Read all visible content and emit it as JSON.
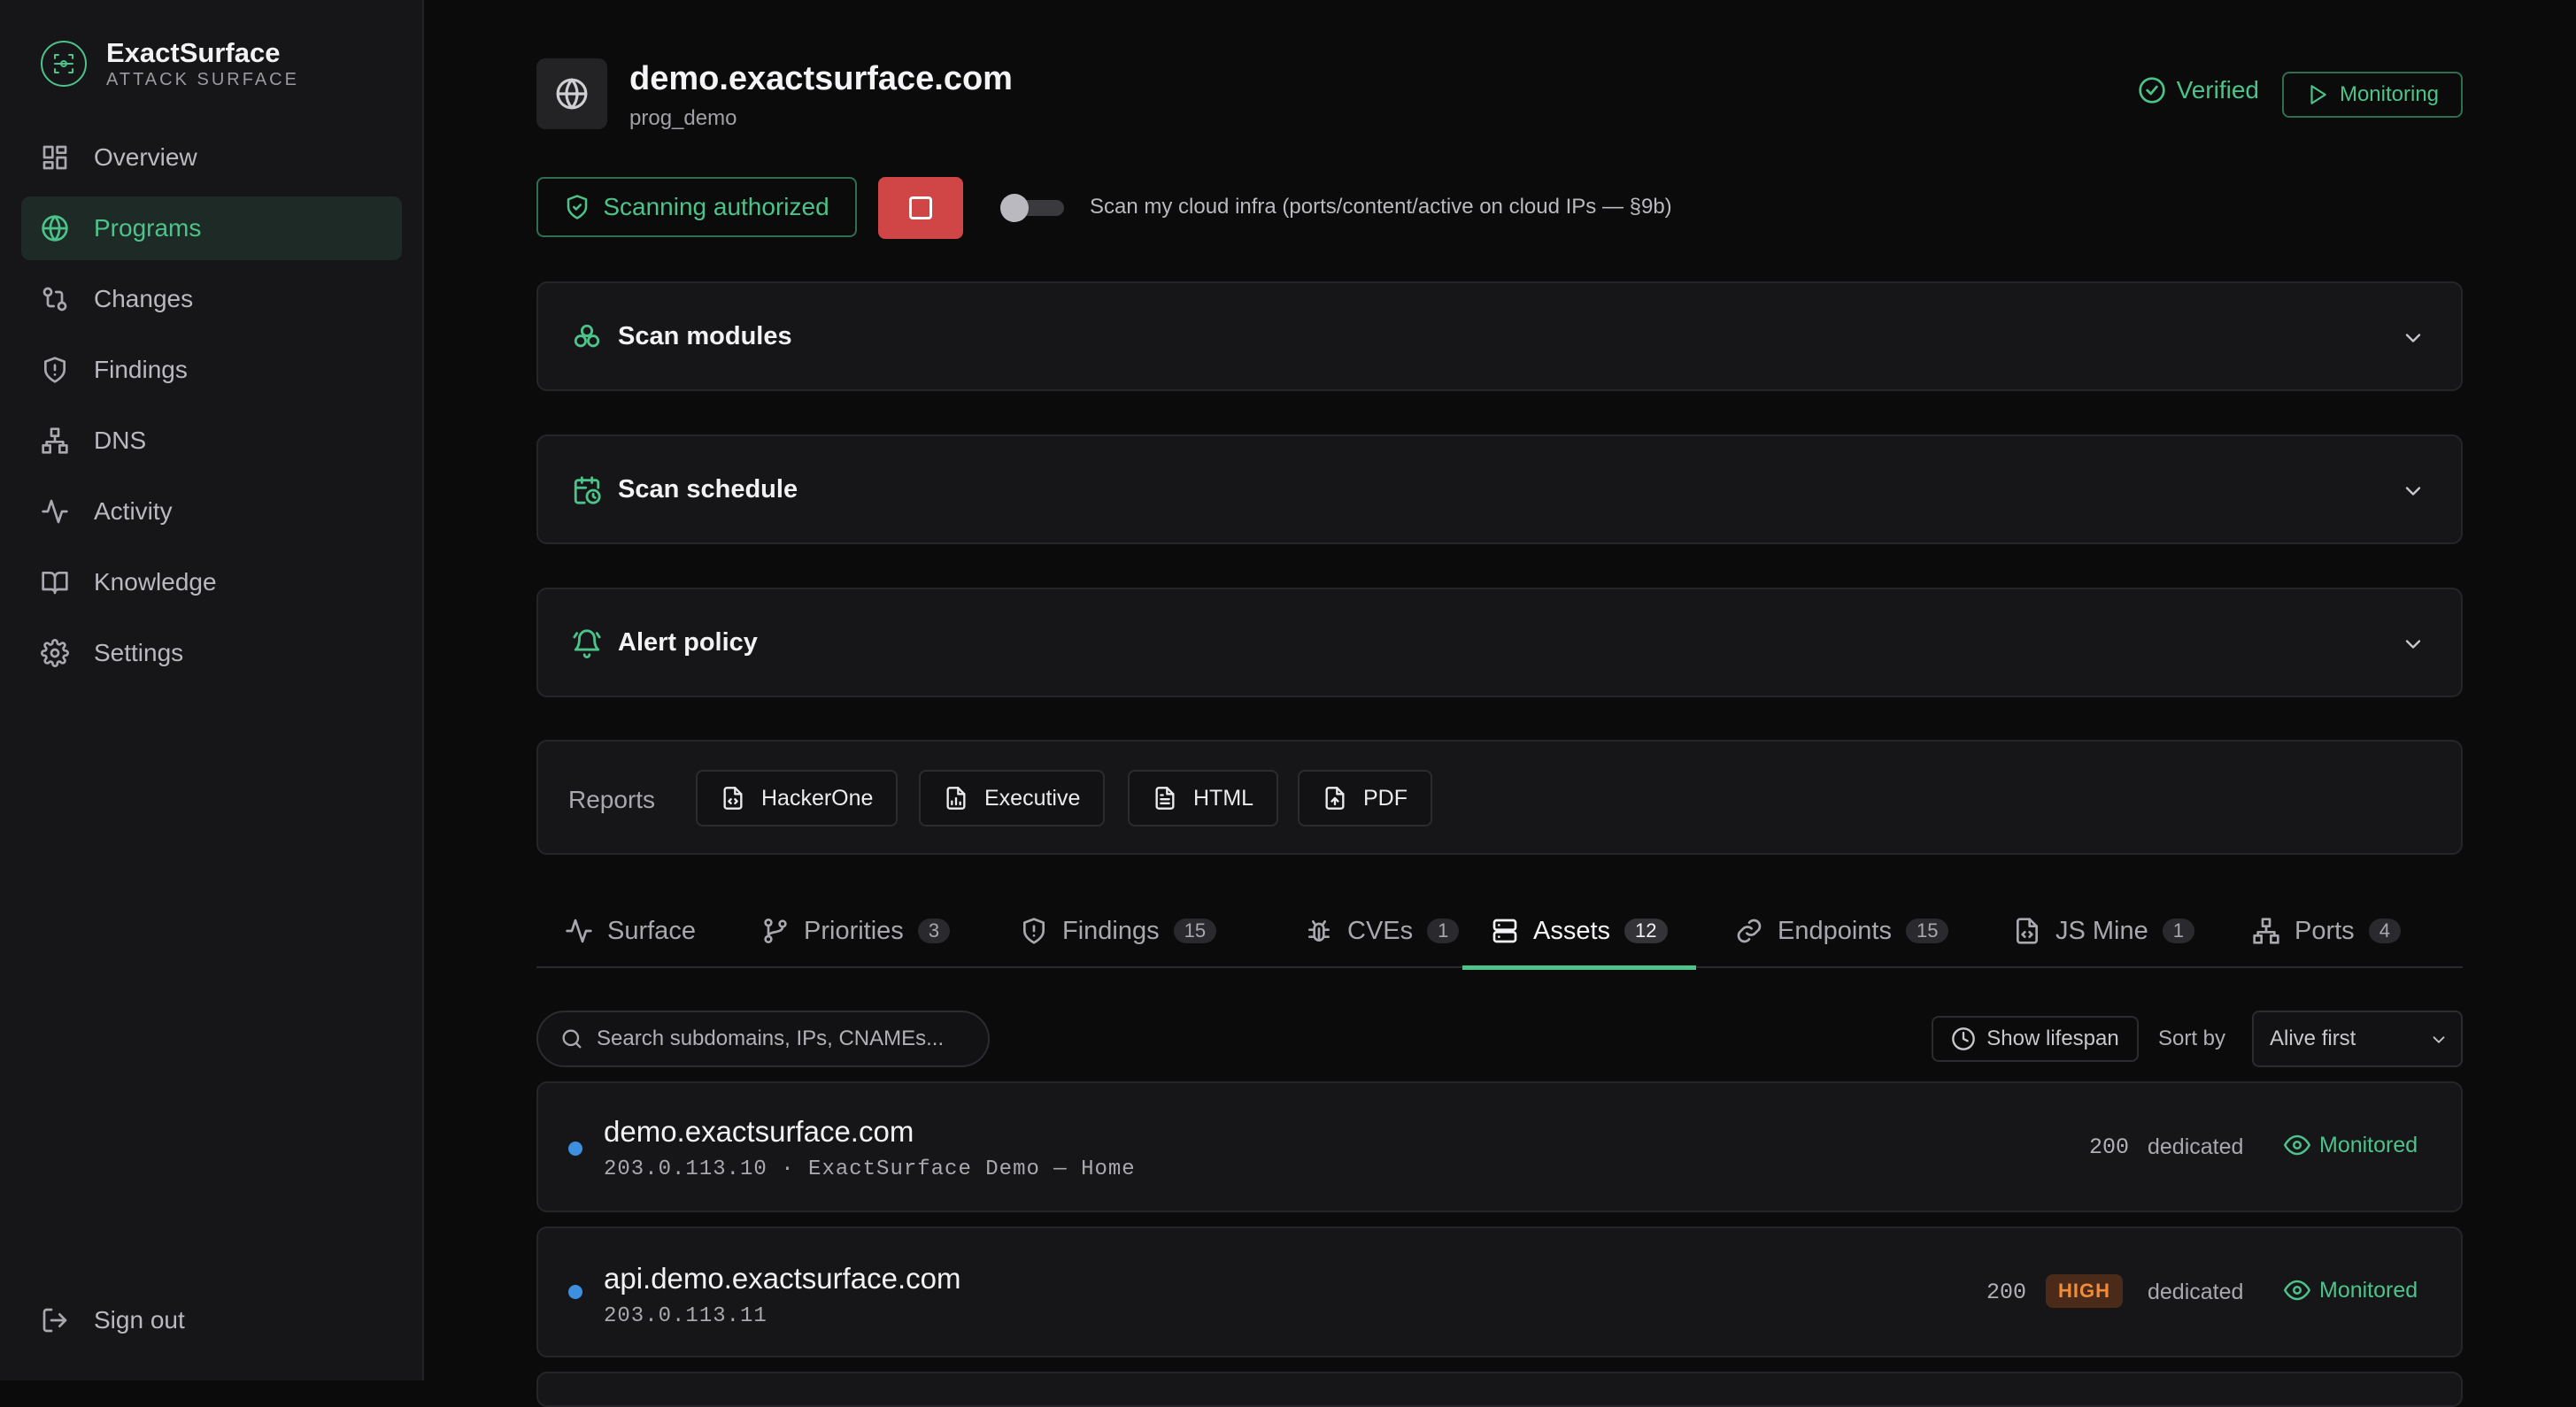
{
  "brand": {
    "name": "ExactSurface",
    "subtitle": "ATTACK SURFACE"
  },
  "nav": [
    {
      "label": "Overview",
      "icon": "grid-icon",
      "active": false
    },
    {
      "label": "Programs",
      "icon": "globe-icon",
      "active": true
    },
    {
      "label": "Changes",
      "icon": "git-compare-icon",
      "active": false
    },
    {
      "label": "Findings",
      "icon": "shield-icon",
      "active": false
    },
    {
      "label": "DNS",
      "icon": "network-icon",
      "active": false
    },
    {
      "label": "Activity",
      "icon": "activity-icon",
      "active": false
    },
    {
      "label": "Knowledge",
      "icon": "book-icon",
      "active": false
    },
    {
      "label": "Settings",
      "icon": "gear-icon",
      "active": false
    }
  ],
  "sign_out": "Sign out",
  "header": {
    "title": "demo.exactsurface.com",
    "program": "prog_demo",
    "verified": "Verified",
    "monitoring": "Monitoring"
  },
  "actions": {
    "scan_authorized": "Scanning authorized",
    "cloud_toggle_label": "Scan my cloud infra (ports/content/active on cloud IPs — §9b)",
    "cloud_toggle_on": false
  },
  "panels": [
    {
      "title": "Scan modules",
      "icon": "modules-icon"
    },
    {
      "title": "Scan schedule",
      "icon": "calendar-clock-icon"
    },
    {
      "title": "Alert policy",
      "icon": "bell-icon"
    }
  ],
  "reports": {
    "label": "Reports",
    "buttons": [
      "HackerOne",
      "Executive",
      "HTML",
      "PDF"
    ]
  },
  "tabs": [
    {
      "label": "Surface",
      "count": null,
      "icon": "activity-icon",
      "active": false
    },
    {
      "label": "Priorities",
      "count": "3",
      "icon": "git-branch-icon",
      "active": false
    },
    {
      "label": "Findings",
      "count": "15",
      "icon": "shield-icon",
      "active": false
    },
    {
      "label": "CVEs",
      "count": "1",
      "icon": "bug-icon",
      "active": false
    },
    {
      "label": "Assets",
      "count": "12",
      "icon": "server-icon",
      "active": true
    },
    {
      "label": "Endpoints",
      "count": "15",
      "icon": "link-icon",
      "active": false
    },
    {
      "label": "JS Mine",
      "count": "1",
      "icon": "file-code-icon",
      "active": false
    },
    {
      "label": "Ports",
      "count": "4",
      "icon": "network-icon",
      "active": false
    }
  ],
  "toolbar": {
    "search_placeholder": "Search subdomains, IPs, CNAMEs...",
    "show_lifespan": "Show lifespan",
    "sort_by_label": "Sort by",
    "sort_value": "Alive first"
  },
  "assets": [
    {
      "host": "demo.exactsurface.com",
      "meta": "203.0.113.10 · ExactSurface Demo — Home",
      "status": "200",
      "severity": null,
      "hosting": "dedicated",
      "state": "Monitored"
    },
    {
      "host": "api.demo.exactsurface.com",
      "meta": "203.0.113.11",
      "status": "200",
      "severity": "HIGH",
      "hosting": "dedicated",
      "state": "Monitored"
    }
  ],
  "colors": {
    "accent": "#4cc38a",
    "danger": "#d04545",
    "severity_high": "#f08c3c",
    "alive_dot": "#3f8fe0"
  }
}
